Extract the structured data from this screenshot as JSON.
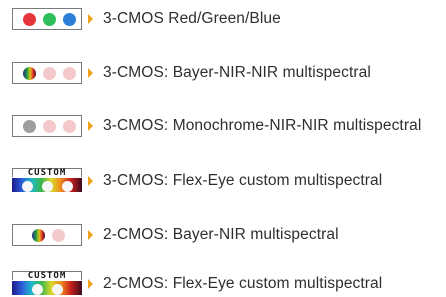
{
  "sensors": [
    {
      "label": "3-CMOS Red/Green/Blue",
      "icon": "rgb-three-sensors",
      "dots": [
        "#e6343b",
        "#2fbf5a",
        "#2d7fd9"
      ]
    },
    {
      "label": "3-CMOS: Bayer-NIR-NIR multispectral",
      "icon": "bayer-nir-nir-sensors",
      "dots": [
        "bayer",
        "#f3c9cc",
        "#f3c9cc"
      ]
    },
    {
      "label": "3-CMOS: Monochrome-NIR-NIR multispectral",
      "icon": "mono-nir-nir-sensors",
      "dots": [
        "#9e9e9e",
        "#f3c9cc",
        "#f3c9cc"
      ]
    },
    {
      "label": "3-CMOS: Flex-Eye custom multispectral",
      "icon": "custom-three-sensors",
      "custom_text": "CUSTOM"
    },
    {
      "label": "2-CMOS: Bayer-NIR multispectral",
      "icon": "bayer-nir-sensors",
      "dots": [
        "bayer",
        "#f3c9cc"
      ]
    },
    {
      "label": "2-CMOS: Flex-Eye custom multispectral",
      "icon": "custom-two-sensors",
      "custom_text": "CUSTOM"
    }
  ],
  "colors": {
    "accent_arrow": "#f2a21a",
    "text": "#2f2f2f",
    "border": "#7a7a7a"
  }
}
